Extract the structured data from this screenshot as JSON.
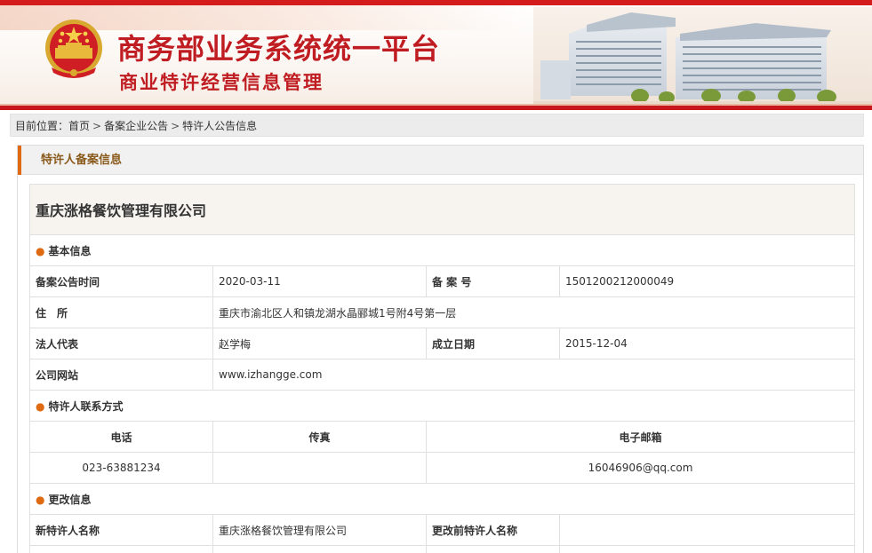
{
  "banner": {
    "title": "商务部业务系统统一平台",
    "subtitle": "商业特许经营信息管理"
  },
  "breadcrumb": {
    "prefix": "目前位置：",
    "items": [
      "首页",
      "备案企业公告",
      "特许人公告信息"
    ],
    "separator": ">"
  },
  "panel": {
    "title": "特许人备案信息"
  },
  "company": {
    "name": "重庆涨格餐饮管理有限公司"
  },
  "basic": {
    "section_title": "基本信息",
    "announce_time_label": "备案公告时间",
    "announce_time": "2020-03-11",
    "record_no_label": "备 案 号",
    "record_no": "1501200212000049",
    "address_label": "住　所",
    "address": "重庆市渝北区人和镇龙湖水晶郦城1号附4号第一层",
    "legal_rep_label": "法人代表",
    "legal_rep": "赵学梅",
    "founded_label": "成立日期",
    "founded": "2015-12-04",
    "website_label": "公司网站",
    "website": "www.izhangge.com"
  },
  "contact": {
    "section_title": "特许人联系方式",
    "phone_label": "电话",
    "fax_label": "传真",
    "email_label": "电子邮箱",
    "phone": "023-63881234",
    "fax": "",
    "email": "16046906@qq.com"
  },
  "changes": {
    "section_title": "更改信息",
    "new_name_label": "新特许人名称",
    "new_name": "重庆涨格餐饮管理有限公司",
    "old_name_label": "更改前特许人名称",
    "old_name": ""
  },
  "colors": {
    "brand_red": "#c01d22",
    "accent_orange": "#e06a12"
  }
}
